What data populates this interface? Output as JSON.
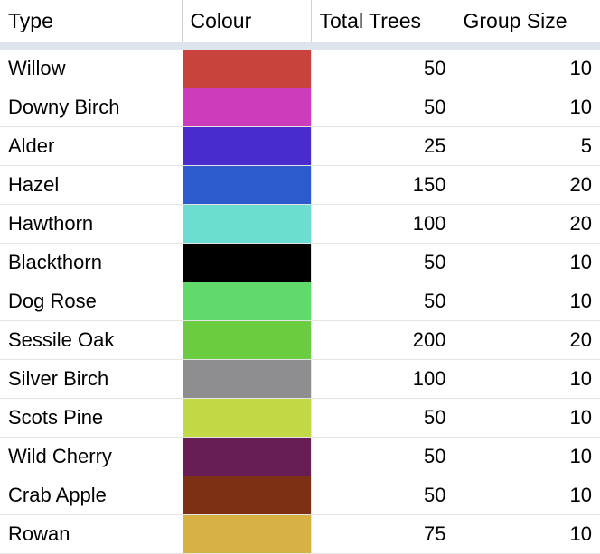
{
  "table": {
    "columns": [
      {
        "key": "type",
        "label": "Type"
      },
      {
        "key": "colour",
        "label": "Colour"
      },
      {
        "key": "total",
        "label": "Total Trees"
      },
      {
        "key": "group",
        "label": "Group Size"
      }
    ],
    "rows": [
      {
        "type": "Willow",
        "colour": "#c8433c",
        "total": "50",
        "group": "10"
      },
      {
        "type": "Downy Birch",
        "colour": "#cc3cbb",
        "total": "50",
        "group": "10"
      },
      {
        "type": "Alder",
        "colour": "#4a2bcc",
        "total": "25",
        "group": "5"
      },
      {
        "type": "Hazel",
        "colour": "#2b5bcc",
        "total": "150",
        "group": "20"
      },
      {
        "type": "Hawthorn",
        "colour": "#6bddd1",
        "total": "100",
        "group": "20"
      },
      {
        "type": "Blackthorn",
        "colour": "#000000",
        "total": "50",
        "group": "10"
      },
      {
        "type": "Dog Rose",
        "colour": "#61d96b",
        "total": "50",
        "group": "10"
      },
      {
        "type": "Sessile Oak",
        "colour": "#6bcc42",
        "total": "200",
        "group": "20"
      },
      {
        "type": "Silver Birch",
        "colour": "#8e8e91",
        "total": "100",
        "group": "10"
      },
      {
        "type": "Scots Pine",
        "colour": "#c2d844",
        "total": "50",
        "group": "10"
      },
      {
        "type": "Wild Cherry",
        "colour": "#671e55",
        "total": "50",
        "group": "10"
      },
      {
        "type": "Crab Apple",
        "colour": "#7e3015",
        "total": "50",
        "group": "10"
      },
      {
        "type": "Rowan",
        "colour": "#d7b144",
        "total": "75",
        "group": "10"
      }
    ]
  },
  "theme": {
    "header_rule_color": "#dfe3ec",
    "grid_line_color": "#e4e4e4",
    "header_divider_color": "#d0d0d0",
    "background": "#ffffff",
    "text_color": "#000000"
  }
}
